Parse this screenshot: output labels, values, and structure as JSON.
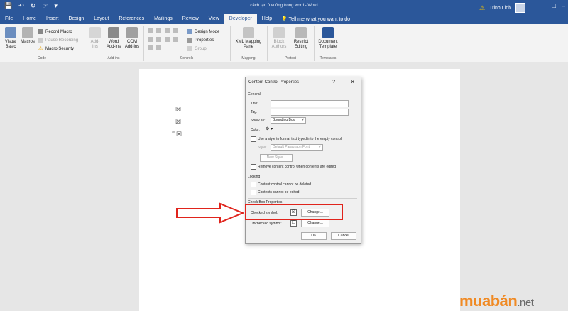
{
  "titlebar": {
    "doc_title": "cách tạo ô vuông trong word - Word",
    "user_name": "Trinh Linh",
    "qat_icons": [
      "save-icon",
      "undo-icon",
      "redo-icon",
      "touch-icon",
      "customize-icon"
    ]
  },
  "tabs": [
    "File",
    "Home",
    "Insert",
    "Design",
    "Layout",
    "References",
    "Mailings",
    "Review",
    "View",
    "Developer",
    "Help"
  ],
  "active_tab": "Developer",
  "tell_me": "Tell me what you want to do",
  "ribbon": {
    "code": {
      "label": "Code",
      "visual_basic": "Visual Basic",
      "macros": "Macros",
      "record_macro": "Record Macro",
      "pause_recording": "Pause Recording",
      "macro_security": "Macro Security"
    },
    "addins": {
      "label": "Add-ins",
      "add_ins": "Add-ins",
      "word_addins": "Word Add-ins",
      "com_addins": "COM Add-ins"
    },
    "controls": {
      "label": "Controls",
      "design_mode": "Design Mode",
      "properties": "Properties",
      "group": "Group"
    },
    "mapping": {
      "label": "Mapping",
      "xml_mapping_pane": "XML Mapping Pane"
    },
    "protect": {
      "label": "Protect",
      "block_authors": "Block Authors",
      "restrict_editing": "Restrict Editing"
    },
    "templates": {
      "label": "Templates",
      "document_template": "Document Template"
    }
  },
  "document": {
    "checkbox_glyph": "☒",
    "control_tag": "cb"
  },
  "dialog": {
    "title": "Content Control Properties",
    "help": "?",
    "close": "✕",
    "general": "General",
    "title_label": "Title:",
    "title_value": "",
    "tag_label": "Tag:",
    "tag_value": "",
    "show_as_label": "Show as:",
    "show_as_value": "Bounding Box",
    "color_label": "Color:",
    "use_style": "Use a style to format text typed into the empty control",
    "style_label": "Style:",
    "style_value": "Default Paragraph Font",
    "new_style": "New Style...",
    "remove_control": "Remove content control when contents are edited",
    "locking": "Locking",
    "cannot_delete": "Content control cannot be deleted",
    "cannot_edit": "Contents cannot be edited",
    "checkbox_props": "Check Box Properties",
    "checked_symbol": "Checked symbol:",
    "checked_glyph": "☒",
    "unchecked_symbol": "Unchecked symbol:",
    "unchecked_glyph": "☐",
    "change1": "Change...",
    "change2": "Change...",
    "ok": "OK",
    "cancel": "Cancel"
  },
  "watermark": {
    "brand": "muabán",
    "suffix": ".net"
  },
  "colors": {
    "ribbon_blue": "#2b579a",
    "highlight_red": "#e0241c",
    "watermark_orange": "#f08a24"
  }
}
